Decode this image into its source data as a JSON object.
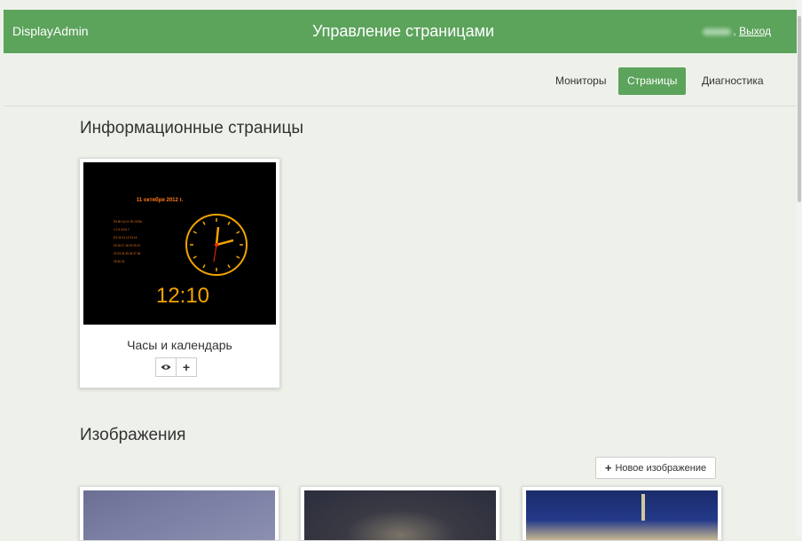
{
  "header": {
    "brand": "DisplayAdmin",
    "title": "Управление страницами",
    "logout": "Выход",
    "comma": ", "
  },
  "nav": [
    {
      "label": "Мониторы"
    },
    {
      "label": "Страницы"
    },
    {
      "label": "Диагностика"
    }
  ],
  "sections": {
    "info_pages": {
      "title": "Информационные страницы",
      "cards": [
        {
          "title": "Часы и календарь",
          "preview": {
            "date": "11 октября 2012 г.",
            "time": "12:10",
            "weekdays": "Пн Вт Ср Чт Пт Сб Вс",
            "weeks": [
              "1 2 3 4 5 6 7",
              "8 9 10 11 12 13 14",
              "15 16 17 18 19 20 21",
              "22 23 24 25 26 27 28",
              "29 30 31"
            ]
          },
          "actions": [
            {
              "icon": "eye-icon"
            },
            {
              "icon": "plus-icon"
            }
          ]
        }
      ]
    },
    "images": {
      "title": "Изображения",
      "new_button": "Новое изображение"
    }
  },
  "colors": {
    "accent": "#5ca35c",
    "background": "#eef1ea",
    "clock": "#f2a400"
  }
}
